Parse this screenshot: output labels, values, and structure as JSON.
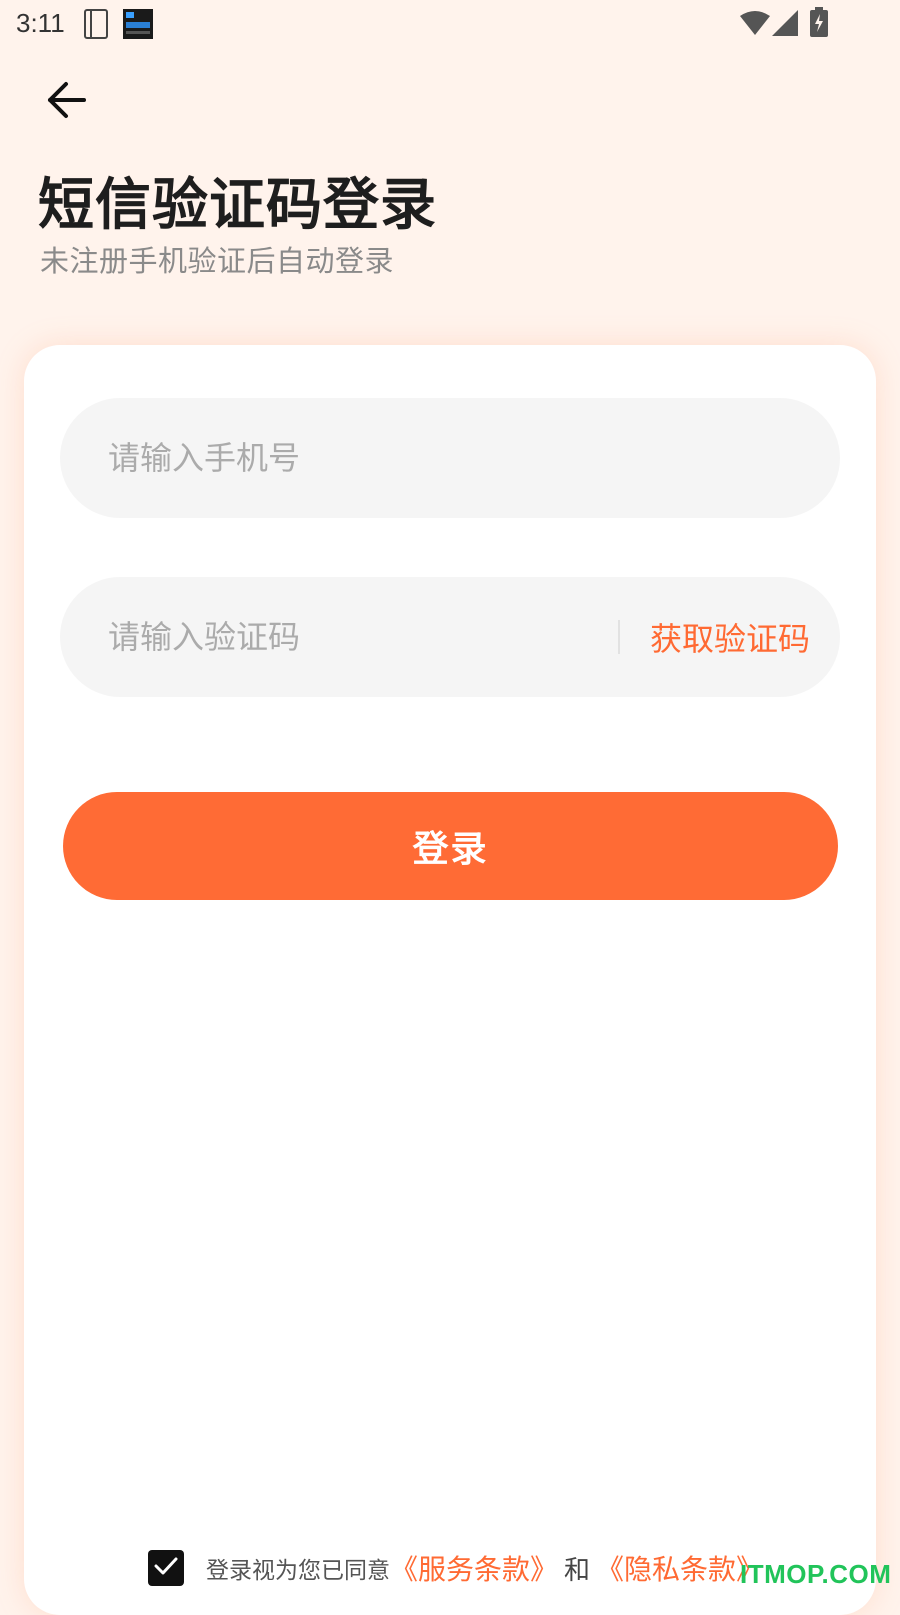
{
  "status_bar": {
    "time": "3:11",
    "left_icons": [
      "sim-card-icon",
      "app-notification-icon"
    ],
    "right_icons": [
      "wifi-icon",
      "cellular-signal-icon",
      "battery-charging-icon"
    ]
  },
  "header": {
    "back_icon": "arrow-left-icon",
    "title": "短信验证码登录",
    "subtitle": "未注册手机验证后自动登录"
  },
  "form": {
    "phone_placeholder": "请输入手机号",
    "phone_value": "",
    "code_placeholder": "请输入验证码",
    "code_value": "",
    "get_code_label": "获取验证码",
    "login_label": "登录"
  },
  "agreement": {
    "checked": true,
    "prefix": "登录视为您已同意",
    "service_terms": "《服务条款》",
    "and": "和",
    "privacy_terms": "《隐私条款》"
  },
  "watermark": "ITMOP.COM",
  "colors": {
    "accent": "#FF6B35",
    "background": "#FFF3EC",
    "input_bg": "#F5F5F5",
    "watermark": "#21C45A"
  }
}
